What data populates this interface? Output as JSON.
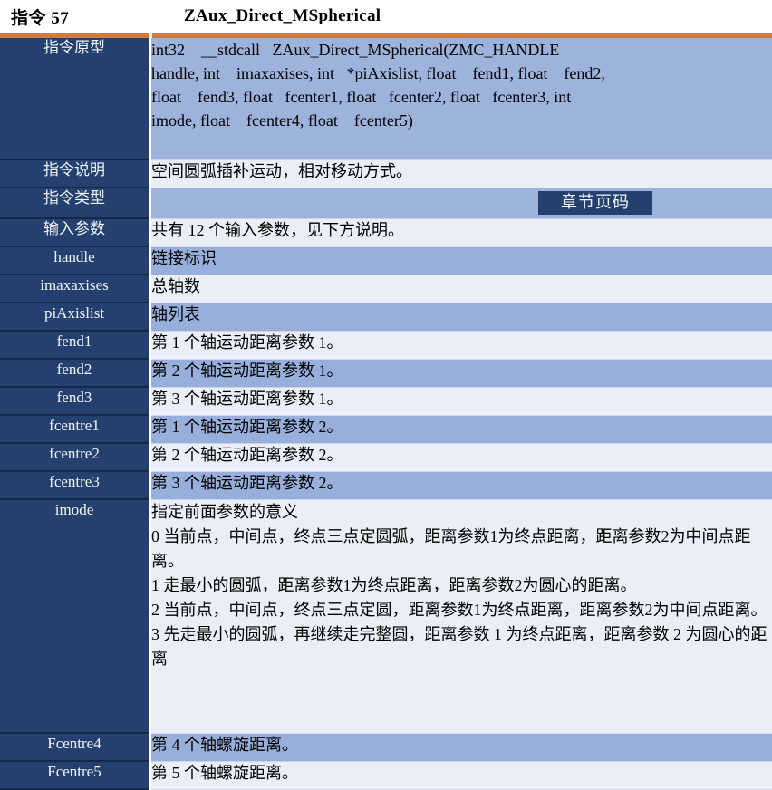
{
  "header": {
    "instruction_number": "指令 57",
    "function_name": "ZAux_Direct_MSpherical"
  },
  "colors": {
    "accent_orange": "#E2762B",
    "label_blue": "#24406E",
    "row_blue": "#98AFDB",
    "row_light": "#EBEEF6"
  },
  "table": {
    "prototype": {
      "label": "指令原型",
      "lines": [
        "int32    __stdcall   ZAux_Direct_MSpherical(ZMC_HANDLE",
        "handle, int    imaxaxises, int   *piAxislist, float    fend1, float    fend2,",
        "float    fend3, float   fcenter1, float   fcenter2, float   fcenter3, int",
        "imode, float    fcenter4, float    fcenter5)"
      ]
    },
    "description": {
      "label": "指令说明",
      "value": "空间圆弧插补运动，相对移动方式。"
    },
    "type": {
      "label": "指令类型",
      "value": "",
      "chapter_badge": "章节页码"
    },
    "input_params": {
      "label": "输入参数",
      "value": "共有 12 个输入参数，见下方说明。"
    },
    "params": [
      {
        "name": "handle",
        "desc": "链接标识"
      },
      {
        "name": "imaxaxises",
        "desc": "总轴数"
      },
      {
        "name": "piAxislist",
        "desc": "轴列表"
      },
      {
        "name": "fend1",
        "desc": "第 1 个轴运动距离参数 1。"
      },
      {
        "name": "fend2",
        "desc": "第 2 个轴运动距离参数 1。"
      },
      {
        "name": "fend3",
        "desc": "第 3 个轴运动距离参数 1。"
      },
      {
        "name": "fcentre1",
        "desc": "第 1 个轴运动距离参数 2。"
      },
      {
        "name": "fcentre2",
        "desc": "第 2 个轴运动距离参数 2。"
      },
      {
        "name": "fcentre3",
        "desc": "第 3 个轴运动距离参数 2。"
      }
    ],
    "imode": {
      "label": "imode",
      "lines": [
        "指定前面参数的意义",
        "0 当前点，中间点，终点三点定圆弧，距离参数1为终点距离，距离参数2为中间点距离。",
        "1 走最小的圆弧，距离参数1为终点距离，距离参数2为圆心的距离。",
        "2 当前点，中间点，终点三点定圆，距离参数1为终点距离，距离参数2为中间点距离。",
        "3 先走最小的圆弧，再继续走完整圆，距离参数 1 为终点距离，距离参数 2 为圆心的距离"
      ]
    },
    "params_tail": [
      {
        "name": "Fcentre4",
        "desc": "第 4 个轴螺旋距离。"
      },
      {
        "name": "Fcentre5",
        "desc": "第 5 个轴螺旋距离。"
      }
    ]
  }
}
